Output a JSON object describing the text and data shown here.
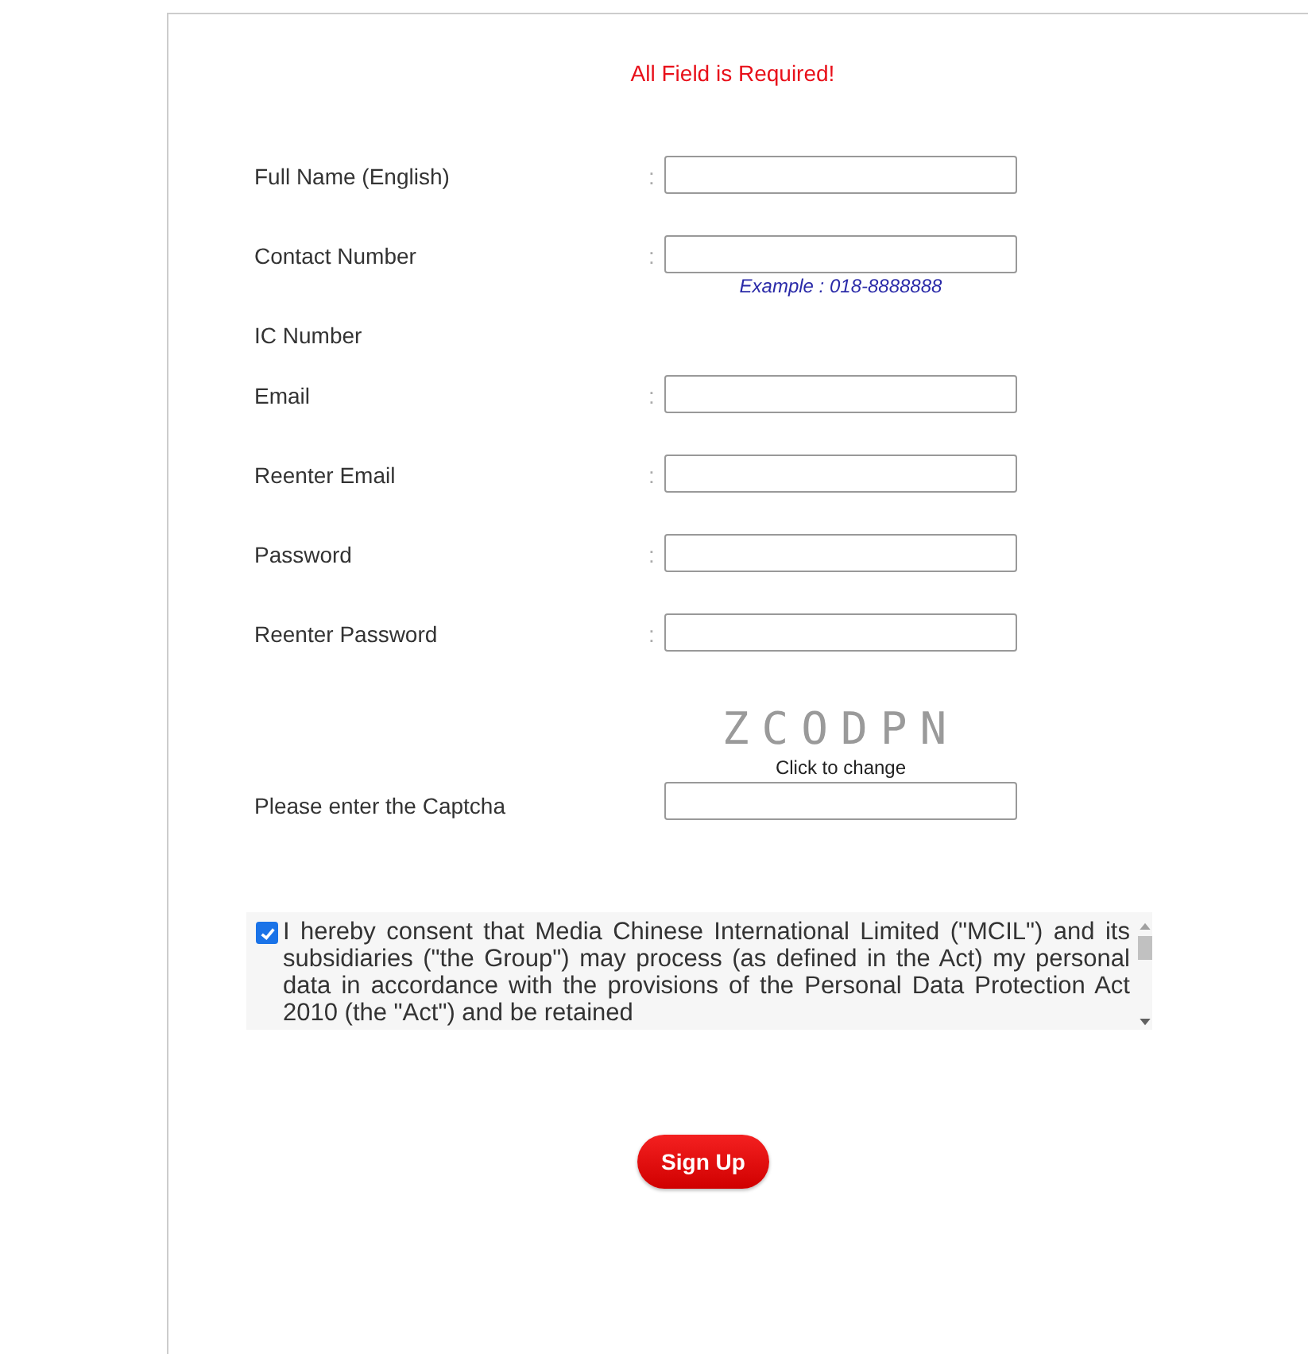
{
  "notice": "All Field is Required!",
  "rows": [
    {
      "kind": "field",
      "label": "Full Name (English)",
      "colon": ":"
    },
    {
      "kind": "field",
      "label": "Contact Number",
      "colon": ":",
      "hint": "Example : 018-8888888"
    },
    {
      "kind": "label",
      "label": "IC Number"
    },
    {
      "kind": "field",
      "label": "Email",
      "colon": ":"
    },
    {
      "kind": "field",
      "label": "Reenter Email",
      "colon": ":"
    },
    {
      "kind": "field",
      "label": "Password",
      "colon": ":"
    },
    {
      "kind": "field",
      "label": "Reenter Password",
      "colon": ":"
    }
  ],
  "captcha": {
    "code": "ZCODPN",
    "link": "Click to change",
    "label": "Please enter the Captcha"
  },
  "consent": {
    "checked": true,
    "text": "I hereby consent that Media Chinese International Limited (\"MCIL\") and its subsidiaries (\"the Group\") may process (as defined in the Act) my personal data in accordance with the provisions of the Personal Data Protection Act 2010 (the \"Act\") and be retained"
  },
  "submit": "Sign Up"
}
